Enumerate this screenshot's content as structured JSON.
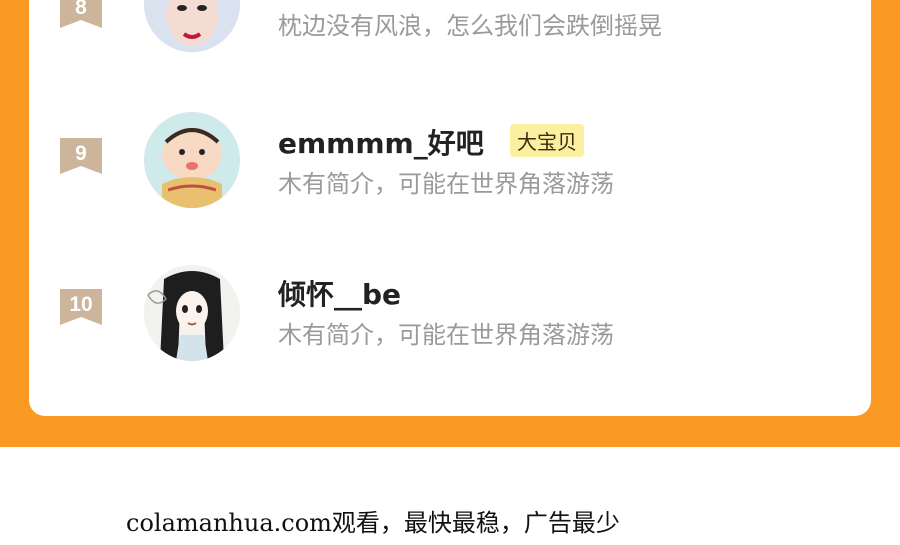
{
  "ranking": [
    {
      "rank": "8",
      "desc": "枕边没有风浪，怎么我们会跌倒摇晃"
    },
    {
      "rank": "9",
      "name": "emmmm_好吧",
      "badge": "大宝贝",
      "desc": "木有简介，可能在世界角落游荡"
    },
    {
      "rank": "10",
      "name": "倾怀__be",
      "desc": "木有简介，可能在世界角落游荡"
    }
  ],
  "footer": {
    "text": "colamanhua.com观看，最快最稳，广告最少"
  },
  "colors": {
    "frame": "#fb9a22",
    "rank_badge": "#cdb59b",
    "tag_bg": "#fcefa0"
  }
}
